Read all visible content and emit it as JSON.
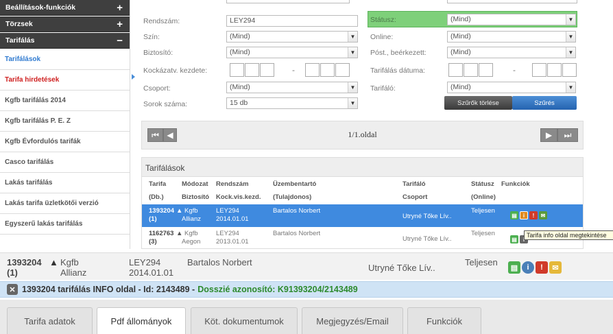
{
  "sidebar": {
    "sections": [
      {
        "label": "Beállítások-funkciók",
        "toggle": "+"
      },
      {
        "label": "Törzsek",
        "toggle": "+"
      },
      {
        "label": "Tarifálás",
        "toggle": "−"
      }
    ],
    "items": [
      {
        "label": "Tarifálások"
      },
      {
        "label": "Tarifa hirdetések"
      },
      {
        "label": "Kgfb tarifálás 2014"
      },
      {
        "label": "Kgfb tarifálás P. E. Z"
      },
      {
        "label": "Kgfb Évfordulós tarifák"
      },
      {
        "label": "Casco tarifálás"
      },
      {
        "label": "Lakás tarifálás"
      },
      {
        "label": "Lakás tarifa üzletkötői verzió"
      },
      {
        "label": "Egyszerű lakás tarifálás"
      }
    ]
  },
  "filter": {
    "rendszam_label": "Rendszám:",
    "rendszam_value": "LEY294",
    "szin_label": "Szín:",
    "szin_value": "(Mind)",
    "biztosito_label": "Biztosító:",
    "biztosito_value": "(Mind)",
    "kockazat_label": "Kockázatv. kezdete:",
    "csoport_label": "Csoport:",
    "csoport_value": "(Mind)",
    "sorok_label": "Sorok száma:",
    "sorok_value": "15 db",
    "statusz_label": "Státusz:",
    "statusz_value": "(Mind)",
    "online_label": "Online:",
    "online_value": "(Mind)",
    "post_label": "Póst., beérkezett:",
    "post_value": "(Mind)",
    "datum_label": "Tarifálás dátuma:",
    "tarifalo_label": "Tarifáló:",
    "tarifalo_value": "(Mind)",
    "dash": "-",
    "clear_button": "Szűrők törlése",
    "filter_button": "Szűrés"
  },
  "pager": {
    "text": "1/1.oldal",
    "first": "⏮",
    "prev": "◀",
    "next": "▶",
    "last": "⏭"
  },
  "table": {
    "title": "Tarifálások",
    "headers1": [
      "Tarifa",
      "Módozat",
      "Rendszám",
      "Üzembentartó",
      "Tarifáló",
      "Státusz",
      "Funkciók"
    ],
    "headers2": [
      "(Db.)",
      "Biztosító",
      "Kock.vis.kezd.",
      "(Tulajdonos)",
      "Csoport",
      "(Online)"
    ],
    "rows": [
      {
        "id": "1393204",
        "db": "(1)",
        "modozat": "Kgfb",
        "biztosito": "Allianz",
        "rendszam": "LEY294",
        "kezd": "2014.01.01",
        "uzembentarto": "Bartalos Norbert",
        "tarifalo": "Utryné Tőke Lív..",
        "statusz": "Teljesen"
      },
      {
        "id": "1162763",
        "db": "(3)",
        "modozat": "Kgfb",
        "biztosito": "Aegon",
        "rendszam": "LEY294",
        "kezd": "2013.01.01",
        "uzembentarto": "Bartalos Norbert",
        "tarifalo": "Utryné Tőke Lív..",
        "statusz": "Teljesen"
      }
    ],
    "tooltip": "Tarifa info oldal megtekintése"
  },
  "detail": {
    "id": "1393204",
    "db": "(1)",
    "modozat": "Kgfb",
    "biztosito": "Allianz",
    "rendszam": "LEY294",
    "kezd": "2014.01.01",
    "uzembentarto": "Bartalos Norbert",
    "tarifalo": "Utryné Tőke Lív..",
    "statusz": "Teljesen"
  },
  "info_bar": {
    "close": "✕",
    "text": "1393204 tarifálás INFO oldal - Id: 2143489 - ",
    "dossier": "Dosszié azonosító: K91393204/2143489"
  },
  "tabs": [
    {
      "label": "Tarifa adatok"
    },
    {
      "label": "Pdf állományok"
    },
    {
      "label": "Köt. dokumentumok"
    },
    {
      "label": "Megjegyzés/Email"
    },
    {
      "label": "Funkciók"
    }
  ],
  "colors": {
    "accent": "#3f8adf",
    "status_green": "#7ed07a",
    "doc_icon": "#4caf50",
    "info_icon": "#e08a1e",
    "alert_icon": "#d03a2a",
    "mail_icon": "#5a9a3a"
  }
}
